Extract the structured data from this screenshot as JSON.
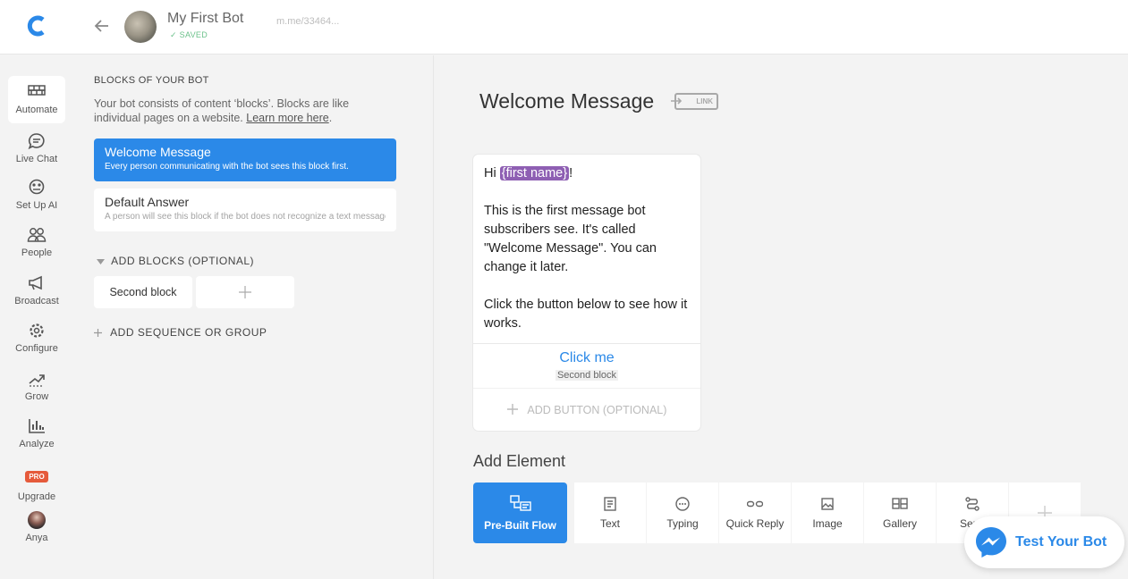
{
  "header": {
    "bot_name": "My First Bot",
    "status": "SAVED",
    "bot_link": "m.me/33464..."
  },
  "nav": {
    "items": [
      {
        "label": "Automate",
        "icon": "bricks-icon",
        "active": true
      },
      {
        "label": "Live Chat",
        "icon": "chat-icon"
      },
      {
        "label": "Set Up AI",
        "icon": "ai-brain-icon"
      },
      {
        "label": "People",
        "icon": "people-icon"
      },
      {
        "label": "Broadcast",
        "icon": "megaphone-icon"
      },
      {
        "label": "Configure",
        "icon": "gear-icon"
      },
      {
        "label": "Grow",
        "icon": "grow-icon"
      },
      {
        "label": "Analyze",
        "icon": "bar-chart-icon"
      },
      {
        "label": "Upgrade",
        "badge": "PRO"
      },
      {
        "label": "Anya",
        "icon": "user-avatar"
      }
    ]
  },
  "blocks_panel": {
    "title": "BLOCKS OF YOUR BOT",
    "description": "Your bot consists of content ‘blocks’. Blocks are like individual pages on a website.",
    "learn_more": "Learn more here",
    "blocks": [
      {
        "title": "Welcome Message",
        "desc": "Every person communicating with the bot sees this block first."
      },
      {
        "title": "Default Answer",
        "desc": "A person will see this block if the bot does not recognize a text message."
      }
    ],
    "add_blocks_label": "ADD BLOCKS (OPTIONAL)",
    "extra_blocks": [
      "Second block"
    ],
    "add_sequence_label": "ADD SEQUENCE OR GROUP"
  },
  "main": {
    "title": "Welcome Message",
    "link_badge": "LINK",
    "message": {
      "greeting_prefix": "Hi ",
      "variable": "{first name}",
      "greeting_suffix": "!",
      "para1": "This is the first message bot subscribers see. It's called \"Welcome Message\". You can change it later.",
      "para2": "Click the button below to see how it works."
    },
    "button": {
      "label": "Click me",
      "target": "Second block"
    },
    "add_button_label": "ADD BUTTON (OPTIONAL)",
    "add_element_title": "Add Element",
    "elements": [
      {
        "label": "Pre-Built Flow",
        "icon": "flow-icon"
      },
      {
        "label": "Text",
        "icon": "text-icon"
      },
      {
        "label": "Typing",
        "icon": "typing-icon"
      },
      {
        "label": "Quick Reply",
        "icon": "quick-reply-icon"
      },
      {
        "label": "Image",
        "icon": "image-icon"
      },
      {
        "label": "Gallery",
        "icon": "gallery-icon"
      },
      {
        "label": "Send",
        "icon": "send-icon"
      }
    ]
  },
  "test_bot": {
    "label": "Test Your Bot",
    "icon": "messenger-icon"
  },
  "colors": {
    "accent": "#2b89e8",
    "variable": "#8e5fb3",
    "saved": "#6cc28b",
    "pro": "#e55a3b"
  }
}
